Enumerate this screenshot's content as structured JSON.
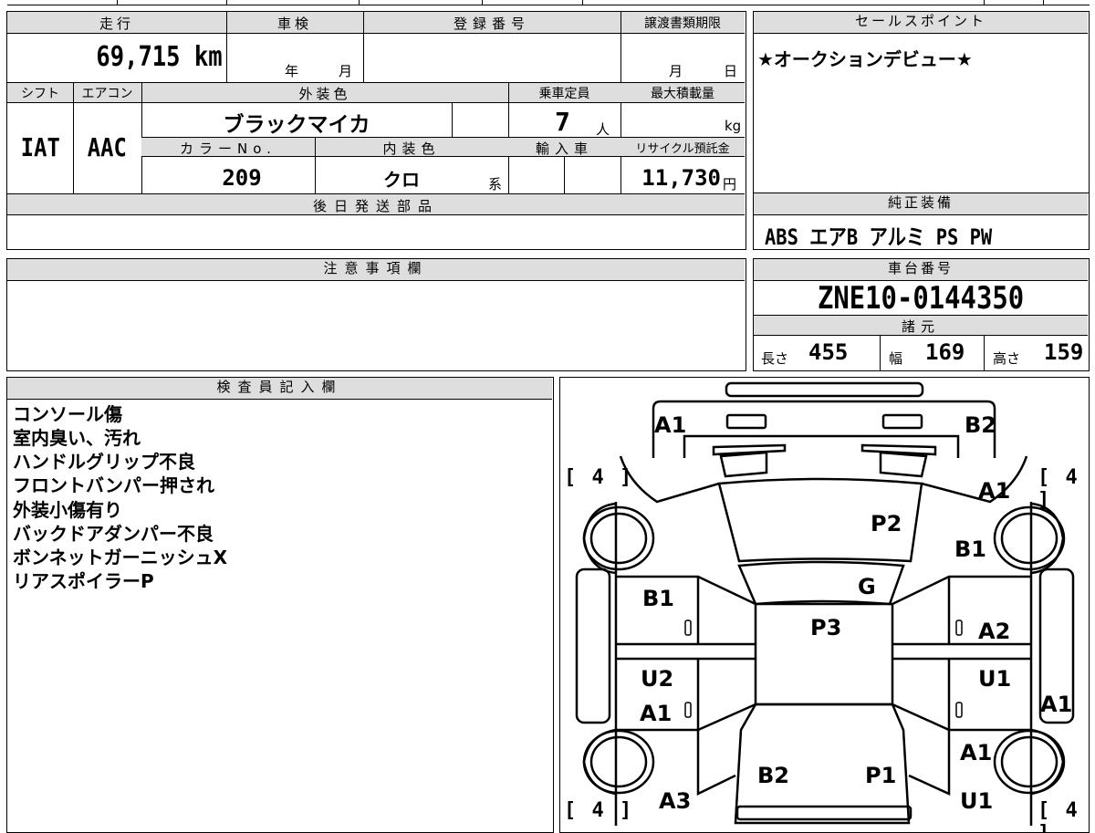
{
  "header": {
    "mileage_label": "走行",
    "shaken_label": "車検",
    "registration_label": "登録番号",
    "transfer_deadline_label": "譲渡書類期限",
    "sales_point_label": "セールスポイント"
  },
  "vehicle": {
    "mileage": "69,715",
    "mileage_unit": "km",
    "shaken_year_unit": "年",
    "shaken_month_unit": "月",
    "deadline_month_unit": "月",
    "deadline_day_unit": "日",
    "shift_label": "シフト",
    "aircon_label": "エアコン",
    "exterior_color_label": "外装色",
    "capacity_label": "乗車定員",
    "max_load_label": "最大積載量",
    "shift": "IAT",
    "aircon": "AAC",
    "exterior_color": "ブラックマイカ",
    "capacity": "7",
    "capacity_unit": "人",
    "load_unit": "kg",
    "color_no_label": "カラーNo.",
    "interior_color_label": "内装色",
    "import_label": "輸入車",
    "recycle_label": "リサイクル預託金",
    "color_no": "209",
    "interior_color": "クロ",
    "interior_suffix": "系",
    "recycle_fee": "11,730",
    "recycle_unit": "円",
    "later_parts_label": "後日発送部品"
  },
  "sales_point": {
    "text": "★オークションデビュー★"
  },
  "standard_equipment": {
    "label": "純正装備",
    "items": "ABS エアB アルミ PS PW"
  },
  "notes": {
    "label": "注意事項欄"
  },
  "chassis": {
    "label": "車台番号",
    "number": "ZNE10-0144350"
  },
  "specs": {
    "label": "諸元",
    "length_label": "長さ",
    "length": "455",
    "width_label": "幅",
    "width": "169",
    "height_label": "高さ",
    "height": "159"
  },
  "inspector": {
    "label": "検査員記入欄",
    "lines": [
      "コンソール傷",
      "室内臭い、汚れ",
      "ハンドルグリップ不良",
      "フロントバンパー押され",
      "外装小傷有り",
      "バックドアダンパー不良",
      "ボンネットガーニッシュX",
      "リアスポイラーP"
    ]
  },
  "diagram": {
    "tire_front_left": "[ 4 ]",
    "tire_front_right": "[ 4 ]",
    "tire_rear_left": "[ 4 ]",
    "tire_rear_right": "[ 4 ]",
    "front_bumper_left": "A1",
    "front_bumper_right": "B2",
    "hood": "P2",
    "windshield": "G",
    "roof": "P3",
    "rear_door_area": "B2",
    "rear_hatch": "P1",
    "left_front_door": "B1",
    "left_rear_door_1": "U2",
    "left_rear_door_2": "A1",
    "left_rear_quarter": "A3",
    "right_front_fender_1": "A1",
    "right_front_fender_2": "B1",
    "right_front_door": "A2",
    "right_rear_door": "U1",
    "right_rear_quarter_1": "A1",
    "right_rear_quarter_2": "U1",
    "right_side_step": "A1"
  }
}
